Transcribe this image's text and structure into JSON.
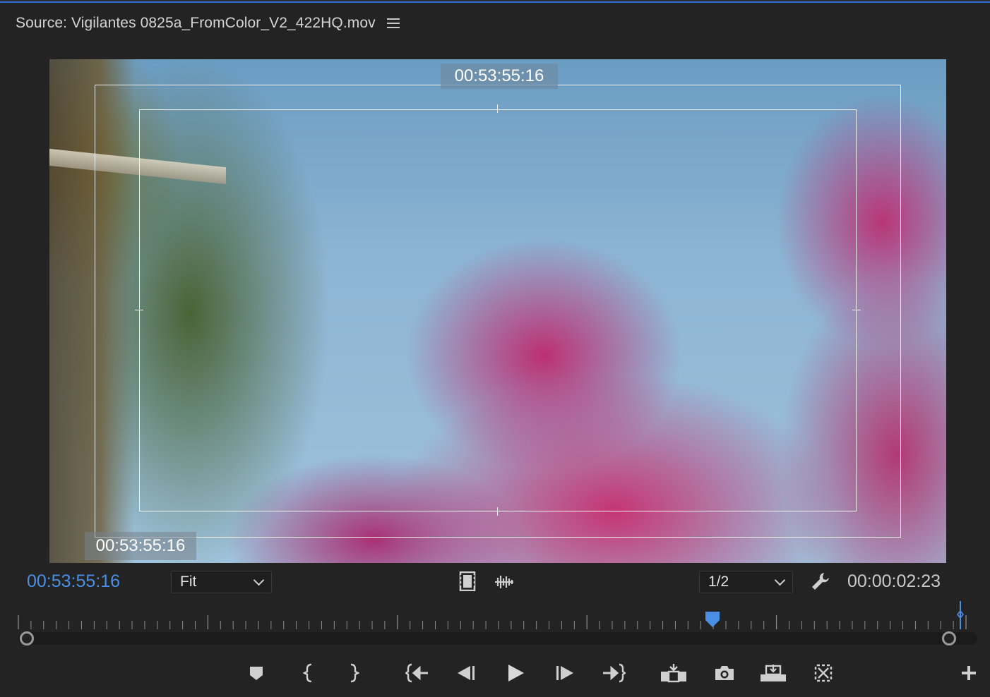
{
  "panel": {
    "title": "Source: Vigilantes 0825a_FromColor_V2_422HQ.mov",
    "menu_icon": "hamburger-menu-icon"
  },
  "viewer": {
    "overlay_timecode_top": "00:53:55:16",
    "overlay_timecode_bottom": "00:53:55:16"
  },
  "controls": {
    "playhead_timecode": "00:53:55:16",
    "zoom_value": "Fit",
    "resolution_value": "1/2",
    "duration_timecode": "00:00:02:23",
    "accent_color": "#4a8fe4",
    "icons": [
      "drag-video-only-icon",
      "drag-audio-only-icon",
      "settings-wrench-icon"
    ]
  },
  "timeline": {
    "playhead_fraction": 0.72
  },
  "transport": {
    "buttons": [
      "add-marker",
      "mark-in",
      "mark-out",
      "go-to-in",
      "step-back",
      "play",
      "step-forward",
      "go-to-out",
      "insert",
      "export-frame",
      "overwrite",
      "toggle-proxies",
      "button-editor"
    ]
  }
}
